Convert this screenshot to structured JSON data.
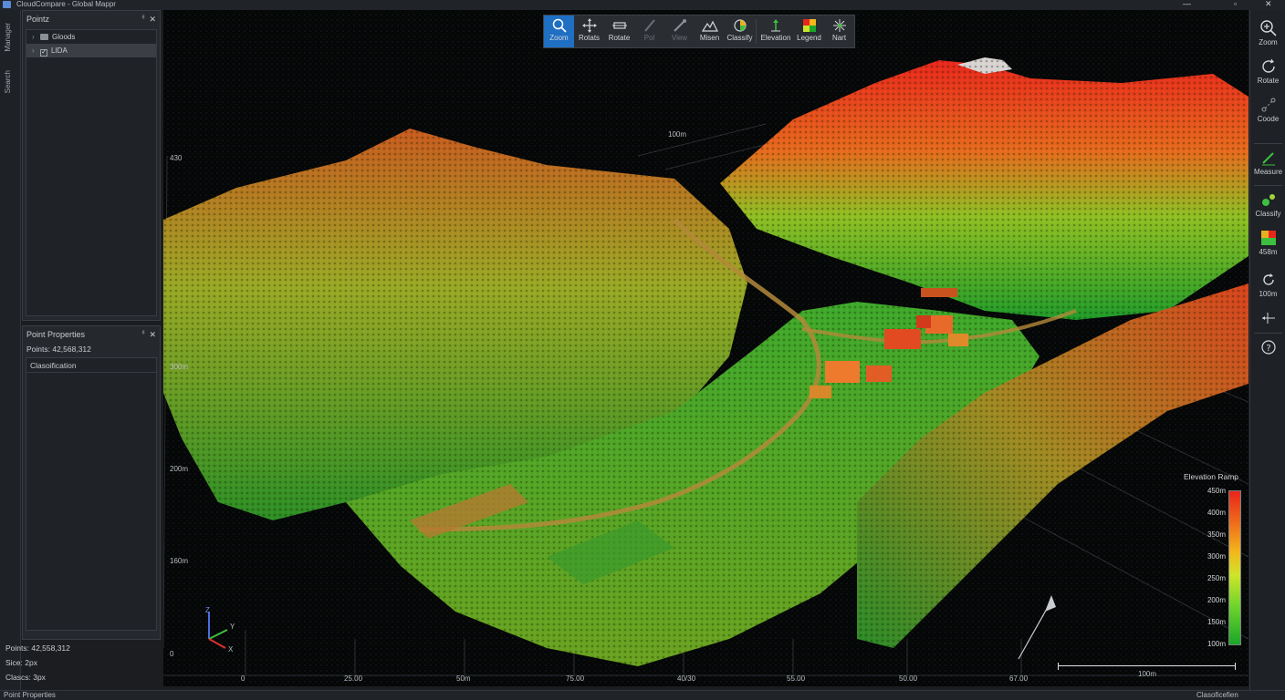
{
  "window": {
    "title": "CloudCompare - Global Mappr",
    "controls": {
      "minimize": "—",
      "maximize": "▫",
      "close": "✕"
    }
  },
  "left_tabs": [
    "Manager",
    "Search"
  ],
  "points_panel": {
    "title": "Pointz",
    "pin": "ᅦ",
    "close": "✕",
    "tree": [
      {
        "label": "Gloods",
        "checked": false,
        "selected": false
      },
      {
        "label": "LIDA",
        "checked": true,
        "selected": true
      }
    ]
  },
  "properties_panel": {
    "title": "Point Properties",
    "points_line": "Points: 42,568,312",
    "class_header": "Clasoification",
    "footer": {
      "points": "Points: 42,558,312",
      "size": "Sice: 2px",
      "class": "Clascs: 3px"
    }
  },
  "toolbar": {
    "buttons": [
      {
        "label": "Zoom",
        "icon": "magnifier-icon",
        "active": true,
        "disabled": false
      },
      {
        "label": "Rotats",
        "icon": "move-arrows-icon",
        "active": false,
        "disabled": false
      },
      {
        "label": "Rotate",
        "icon": "rotate-plane-icon",
        "active": false,
        "disabled": false
      },
      {
        "label": "Pol",
        "icon": "pencil-icon",
        "active": false,
        "disabled": true
      },
      {
        "label": "View",
        "icon": "eyedropper-icon",
        "active": false,
        "disabled": true
      },
      {
        "label": "Misen",
        "icon": "terrain-icon",
        "active": false,
        "disabled": false
      },
      {
        "label": "Classify",
        "icon": "classify-sphere-icon",
        "active": false,
        "disabled": false
      },
      {
        "label": "Elevation",
        "icon": "elevation-icon",
        "active": false,
        "disabled": false
      },
      {
        "label": "Legend",
        "icon": "legend-swatch-icon",
        "active": false,
        "disabled": false
      },
      {
        "label": "Nart",
        "icon": "spark-icon",
        "active": false,
        "disabled": false
      }
    ]
  },
  "right_toolbar": [
    {
      "label": "Zoom",
      "icon": "zoom-icon"
    },
    {
      "label": "Rotate",
      "icon": "rotate-icon"
    },
    {
      "label": "Coode",
      "icon": "code-link-icon"
    },
    {
      "label": "Measure",
      "icon": "ruler-pencil-icon"
    },
    {
      "label": "Classify",
      "icon": "classify-icon"
    },
    {
      "label": "458m",
      "icon": "color-ramp-icon"
    },
    {
      "label": "100m",
      "icon": "refresh-icon"
    },
    {
      "label": "",
      "icon": "axis-icon"
    },
    {
      "label": "",
      "icon": "help-icon"
    }
  ],
  "viewport": {
    "y_labels": [
      "430",
      "300m",
      "200m",
      "160m",
      "0"
    ],
    "x_labels": [
      "0",
      "25.00",
      "50m",
      "75.00",
      "40/30",
      "55.00",
      "50.00",
      "67.00"
    ],
    "grid_label": "100m",
    "axis_gizmo": {
      "z": "Z",
      "y": "Y",
      "x": "X"
    },
    "scale_label": "100m"
  },
  "elevation_ramp": {
    "title": "Elevation Ramp",
    "labels": [
      "450m",
      "400m",
      "350m",
      "300m",
      "250m",
      "200m",
      "150m",
      "100m"
    ],
    "colors": [
      "#e8261b",
      "#ef6a1c",
      "#f2b81d",
      "#cde52a",
      "#6fd42c",
      "#19a629"
    ]
  },
  "status_bar": {
    "left": "Point Properties",
    "right": "Clasoficefien"
  }
}
